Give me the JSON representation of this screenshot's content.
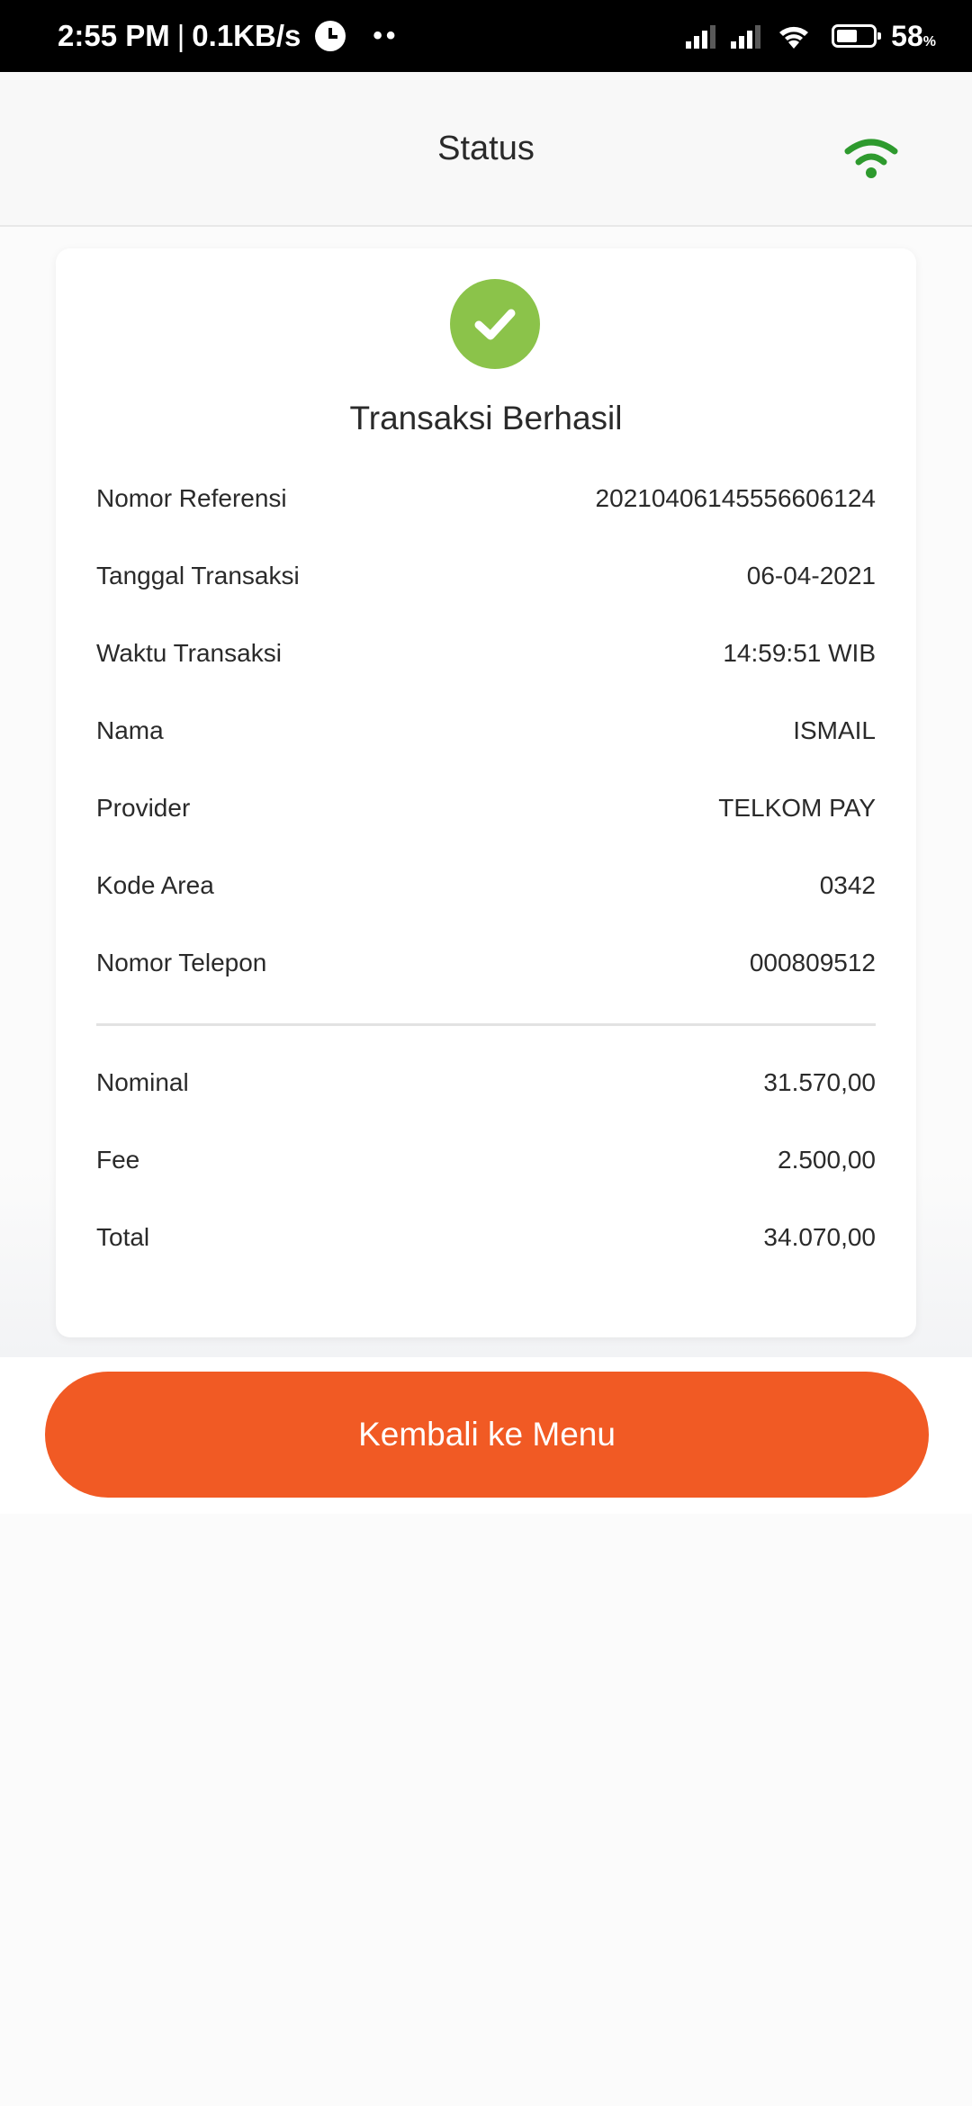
{
  "status_bar": {
    "time": "2:55 PM",
    "separator": "|",
    "net_speed": "0.1KB/s",
    "dots": "••",
    "battery_pct": "58",
    "battery_unit": "%",
    "battery_level": 0.58
  },
  "header": {
    "title": "Status",
    "wifi_icon_color": "#2e9a2e"
  },
  "card": {
    "success_icon": "check-circle-icon",
    "success_color": "#8bc34a",
    "title": "Transaksi Berhasil",
    "details": [
      {
        "label": "Nomor Referensi",
        "value": "20210406145556606124"
      },
      {
        "label": "Tanggal Transaksi",
        "value": "06-04-2021"
      },
      {
        "label": "Waktu Transaksi",
        "value": "14:59:51 WIB"
      },
      {
        "label": "Nama",
        "value": "ISMAIL"
      },
      {
        "label": "Provider",
        "value": "TELKOM PAY"
      },
      {
        "label": "Kode Area",
        "value": "0342"
      },
      {
        "label": "Nomor Telepon",
        "value": "000809512"
      }
    ],
    "summary": [
      {
        "label": "Nominal",
        "value": "31.570,00"
      },
      {
        "label": "Fee",
        "value": "2.500,00"
      },
      {
        "label": "Total",
        "value": "34.070,00"
      }
    ]
  },
  "actions": {
    "back_to_menu_label": "Kembali ke Menu",
    "button_color": "#f15a24"
  }
}
